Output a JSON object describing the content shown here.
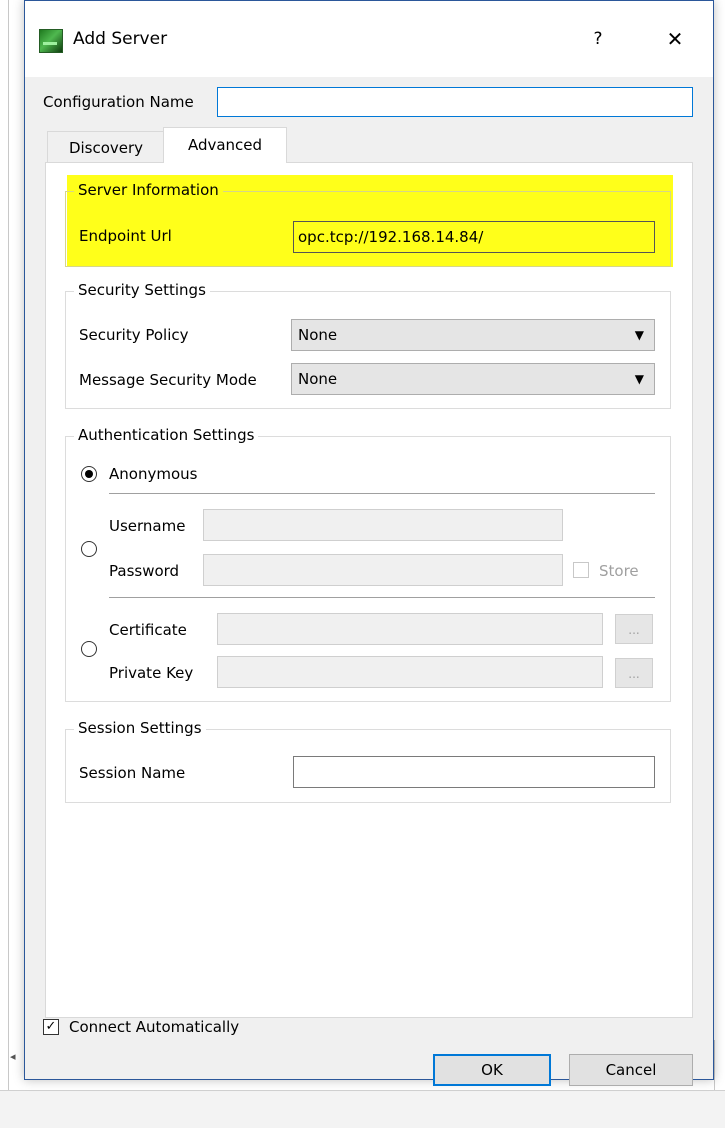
{
  "dialog": {
    "title": "Add Server",
    "help_glyph": "?",
    "close_glyph": "✕"
  },
  "config": {
    "label": "Configuration Name",
    "value": ""
  },
  "tabs": [
    {
      "label": "Discovery"
    },
    {
      "label": "Advanced"
    }
  ],
  "server_info": {
    "title": "Server Information",
    "endpoint_label": "Endpoint Url",
    "endpoint_value": "opc.tcp://192.168.14.84/",
    "highlight_color": "#ffff1a"
  },
  "security": {
    "title": "Security Settings",
    "policy_label": "Security Policy",
    "policy_value": "None",
    "mode_label": "Message Security Mode",
    "mode_value": "None"
  },
  "auth": {
    "title": "Authentication Settings",
    "anonymous_label": "Anonymous",
    "username_label": "Username",
    "password_label": "Password",
    "store_label": "Store",
    "certificate_label": "Certificate",
    "private_key_label": "Private Key",
    "browse_label": "...",
    "selected": "anonymous"
  },
  "session": {
    "title": "Session Settings",
    "name_label": "Session Name",
    "name_value": ""
  },
  "footer": {
    "connect_auto_label": "Connect Automatically",
    "connect_auto_checked": true,
    "check_glyph": "✓",
    "ok_label": "OK",
    "cancel_label": "Cancel"
  },
  "icons": {
    "app": "app-icon",
    "combo_arrow": "▼"
  },
  "colors": {
    "accent": "#0078d7",
    "dialog_border": "#2b579a"
  }
}
